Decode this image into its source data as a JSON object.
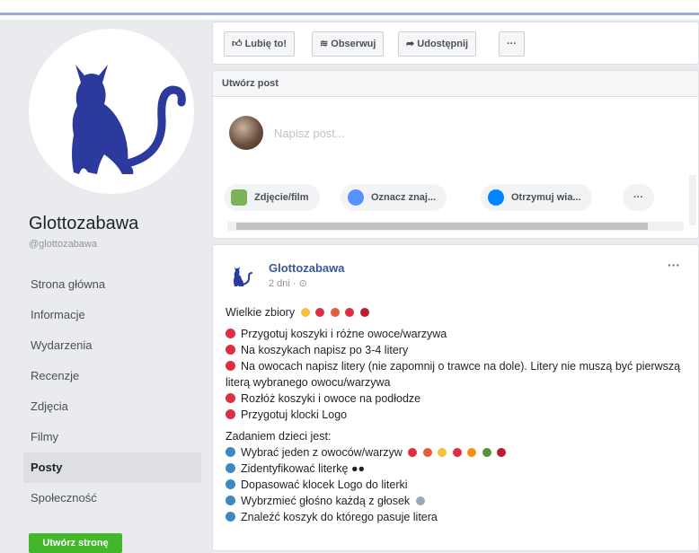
{
  "page": {
    "name": "Glottozabawa",
    "handle": "@glottozabawa"
  },
  "nav": {
    "items": [
      "Strona główna",
      "Informacje",
      "Wydarzenia",
      "Recenzje",
      "Zdjęcia",
      "Filmy",
      "Posty",
      "Społeczność"
    ],
    "active": "Posty",
    "create_label": "Utwórz stronę"
  },
  "actions": {
    "like": "Lubię to!",
    "follow": "Obserwuj",
    "share": "Udostępnij",
    "more": "···"
  },
  "composer": {
    "title": "Utwórz post",
    "placeholder": "Napisz post...",
    "photo": "Zdjęcie/film",
    "tag": "Oznacz znaj...",
    "messages": "Otrzymuj wia...",
    "more": "···"
  },
  "post": {
    "author": "Glottozabawa",
    "time": "2 dni",
    "more": "···",
    "heading": "Wielkie zbiory",
    "steps": [
      "Przygotuj koszyki i różne owoce/warzywa",
      "Na koszykach napisz po 3-4 litery",
      "Na owocach napisz litery (nie zapomnij o trawce na dole). Litery nie muszą być pierwszą literą wybranego owocu/warzywa",
      "Rozłóż koszyki i owoce na podłodze",
      "Przygotuj klocki Logo"
    ],
    "task_intro": "Zadaniem dzieci jest:",
    "tasks": [
      "Wybrać jeden z owoców/warzyw",
      "Zidentyfikować literkę",
      "Dopasować klocek Logo do literki",
      "Wybrzmieć głośno każdą z głosek",
      "Znaleźć koszyk do którego pasuje litera"
    ]
  },
  "colors": {
    "brand_blue": "#2b3a9c",
    "fb_blue": "#4267b2",
    "create_green": "#42b72a",
    "bullet_red": "#dd2e44",
    "bullet_blue": "#3b88c3"
  }
}
